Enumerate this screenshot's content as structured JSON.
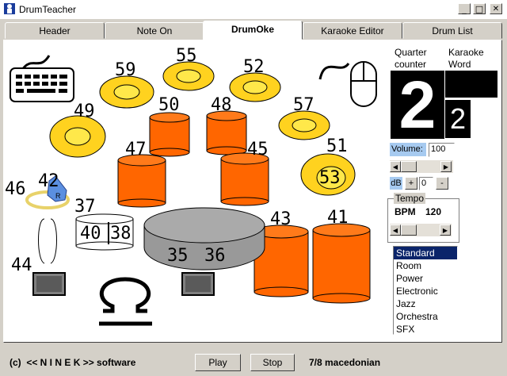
{
  "window": {
    "title": "DrumTeacher",
    "min": "_",
    "max": "□",
    "close": "✕"
  },
  "tabs": [
    {
      "label": "Header"
    },
    {
      "label": "Note On"
    },
    {
      "label": "DrumOke"
    },
    {
      "label": "Karaoke Editor"
    },
    {
      "label": "Drum List"
    }
  ],
  "active_tab": "DrumOke",
  "kit": {
    "numbers": {
      "n59": "59",
      "n55": "55",
      "n52": "52",
      "n49": "49",
      "n50": "50",
      "n48": "48",
      "n57": "57",
      "n47": "47",
      "n45": "45",
      "n51": "51",
      "n53": "53",
      "n46": "46",
      "n42": "42",
      "n37": "37",
      "n40": "40",
      "n38": "38",
      "n35": "35",
      "n36": "36",
      "n43": "43",
      "n41": "41",
      "n44": "44"
    },
    "pad_letter": "R"
  },
  "counter": {
    "quarter_label_1": "Quarter",
    "quarter_label_2": "counter",
    "karaoke_label_1": "Karaoke",
    "karaoke_label_2": "Word",
    "quarter_value": "2",
    "word_value": "2"
  },
  "volume": {
    "label": "Volume:",
    "value": "100",
    "db_label": "dB",
    "plus": "+",
    "db_value": "0",
    "minus": "-"
  },
  "tempo": {
    "group_label": "Tempo",
    "bpm_label": "BPM",
    "bpm_value": "120"
  },
  "styles": [
    "Standard",
    "Room",
    "Power",
    "Electronic",
    "Jazz",
    "Orchestra",
    "SFX"
  ],
  "selected_style": "Standard",
  "footer": {
    "copyright": "(c)  << N I N E K >> software",
    "play": "Play",
    "stop": "Stop",
    "song": "7/8 macedonian"
  },
  "colors": {
    "tom": "#ff6600",
    "cymbal": "#ffd21f",
    "cymbal_inner": "#ffe84a",
    "kick": "#999999",
    "selection": "#0a246a"
  }
}
